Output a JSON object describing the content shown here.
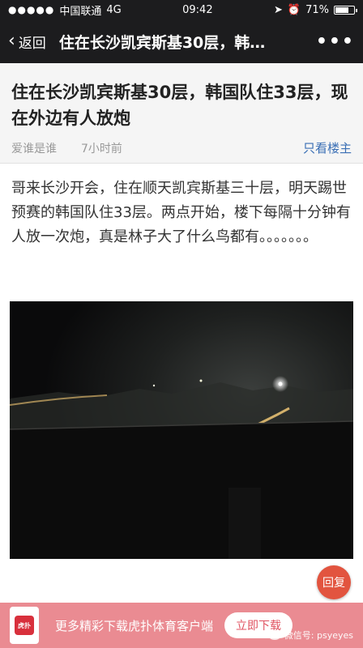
{
  "status": {
    "carrier": "中国联通",
    "network": "4G",
    "time": "09:42",
    "battery_pct": "71%",
    "battery_level": 0.71
  },
  "nav": {
    "back_label": "返回",
    "title": "住在长沙凯宾斯基30层，韩…",
    "more": "•••"
  },
  "post": {
    "title": "住在长沙凯宾斯基30层，韩国队住33层，现在外边有人放炮",
    "author": "爱谁是谁",
    "time": "7小时前",
    "only_op": "只看楼主",
    "body": "哥来长沙开会，住在顺天凯宾斯基三十层，明天踢世预赛的韩国队住33层。两点开始，楼下每隔十分钟有人放一次炮，真是林子大了什么鸟都有。。。。。。。"
  },
  "reply_label": "回复",
  "banner": {
    "text": "更多精彩下载虎扑体育客户端",
    "button": "立即下载",
    "watermark": "微信号: psyeyes"
  },
  "colors": {
    "bar": "#1c1c1e",
    "link": "#3a6fb5",
    "reply": "#e2543f",
    "banner": "#ea8b92"
  }
}
